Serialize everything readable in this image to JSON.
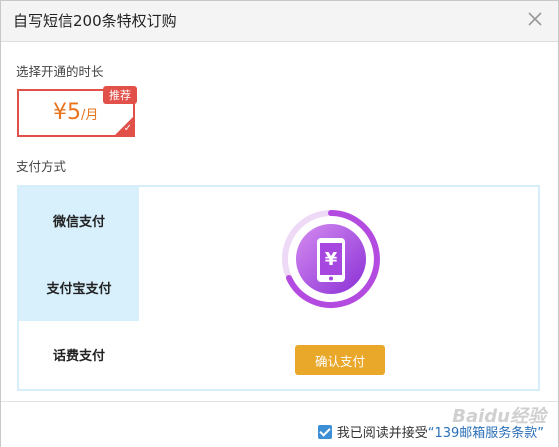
{
  "dialog": {
    "title": "自写短信200条特权订购"
  },
  "duration": {
    "label": "选择开通的时长",
    "plan": {
      "price": "¥5",
      "unit": "/月",
      "badge": "推荐"
    }
  },
  "payment": {
    "label": "支付方式",
    "methods": [
      {
        "label": "微信支付",
        "active": true
      },
      {
        "label": "支付宝支付",
        "active": true
      },
      {
        "label": "话费支付",
        "active": false
      }
    ],
    "icon": "phone-yuan-icon",
    "confirm_label": "确认支付"
  },
  "footer": {
    "agree_text": "我已阅读并接受",
    "terms_link": "“139邮箱服务条款”",
    "checked": true
  },
  "watermark": "Baidu经验",
  "colors": {
    "accent_red": "#e2504a",
    "price_orange": "#e8741e",
    "tab_active_bg": "#d7f0fc",
    "confirm_bg": "#e9a82a",
    "ring_purple": "#b44be0",
    "link_blue": "#2a6fb8"
  }
}
